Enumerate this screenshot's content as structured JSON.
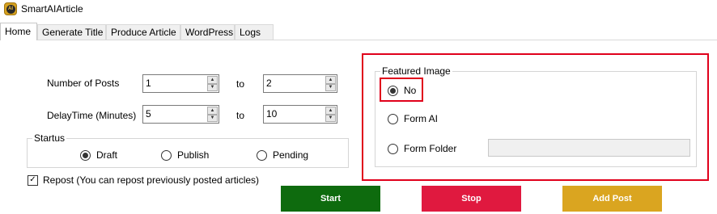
{
  "window": {
    "title": "SmartAIArticle",
    "icon_text": "AI"
  },
  "tabs": [
    {
      "label": "Home",
      "active": true
    },
    {
      "label": "Generate Title"
    },
    {
      "label": "Produce Article"
    },
    {
      "label": "WordPress"
    },
    {
      "label": "Logs"
    }
  ],
  "posts": {
    "label": "Number of Posts",
    "from": "1",
    "to_label": "to",
    "to": "2"
  },
  "delay": {
    "label": "DelayTime (Minutes)",
    "from": "5",
    "to_label": "to",
    "to": "10"
  },
  "status": {
    "legend": "Startus",
    "options": [
      {
        "label": "Draft",
        "checked": true
      },
      {
        "label": "Publish",
        "checked": false
      },
      {
        "label": "Pending",
        "checked": false
      }
    ]
  },
  "repost": {
    "label": "Repost (You can repost previously posted articles)",
    "checked": true
  },
  "featured_image": {
    "legend": "Featured Image",
    "options": [
      {
        "label": "No",
        "checked": true
      },
      {
        "label": "Form AI",
        "checked": false
      },
      {
        "label": "Form Folder",
        "checked": false
      }
    ],
    "folder_path": ""
  },
  "buttons": {
    "start": {
      "label": "Start",
      "color": "#0e6b0e"
    },
    "stop": {
      "label": "Stop",
      "color": "#e0193f"
    },
    "add_post": {
      "label": "Add Post",
      "color": "#daa520"
    }
  },
  "colors": {
    "highlight": "#e0001b"
  }
}
